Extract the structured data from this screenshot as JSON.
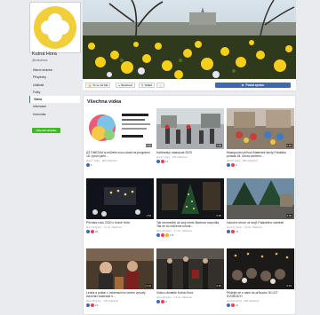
{
  "page": {
    "name": "Kutná Hora",
    "handle": "@kutnahora"
  },
  "nav": [
    {
      "label": "Hlavní stránka",
      "active": false
    },
    {
      "label": "Příspěvky",
      "active": false
    },
    {
      "label": "Události",
      "active": false
    },
    {
      "label": "Fotky",
      "active": false
    },
    {
      "label": "Videa",
      "active": true
    },
    {
      "label": "Informace",
      "active": false
    },
    {
      "label": "Komunita",
      "active": false
    }
  ],
  "create_button": "Vytvořit stránku",
  "actions": {
    "like": "To se mi líbí",
    "follow": "Sledovat",
    "share": "Sdílet",
    "more": "…",
    "send": "Poslat zprávu"
  },
  "section_title": "Všechna videa",
  "videos": [
    {
      "title": "AŽ DNESKA si můžete svou účast na programu 18. výročí jarní...",
      "meta": "před 7 týdny · 486 zhlédnutí",
      "duration": "0:42",
      "reactions": "6"
    },
    {
      "title": "Karlkarský masopust 2020",
      "meta": "před 7 týdny · 925 zhlédnutí",
      "duration": "3:48",
      "reactions": "13"
    },
    {
      "title": "Masopustní průvod Mateřské školy Pohádka pořádá 18. února centrem...",
      "meta": "před 8 týdny · 386 zhlédnutí",
      "duration": "0:45",
      "reactions": "8"
    },
    {
      "title": "Přivítání roku 2020 v Kutné Hoře",
      "meta": "před 10 týdny · 1,1 tis. zhlédnutí",
      "duration": "1:53",
      "reactions": "29"
    },
    {
      "title": "Tak stromeček už stojí místo Barbora rozsvítila. Tak že ho můžeme užívat...",
      "meta": "před 15 týdny · 3,7 tis. zhlédnutí",
      "duration": "0:46",
      "reactions": "115"
    },
    {
      "title": "Vánoční strom už stojí! Palackého náměstí",
      "meta": "před 17 týdny · 1,8 tis. zhlédnutí",
      "duration": "0:46",
      "reactions": "23"
    },
    {
      "title": "Lenka a pošta! v Informačním centru zpívaly Adventní kalendář s …",
      "meta": "před 18 týdny · 454 zhlédnutí",
      "duration": "0:44",
      "reactions": "24"
    },
    {
      "title": "Video uživatele Kutná Hora",
      "meta": "před 18 týdny · 1,5 tis. zhlédnutí",
      "duration": "0:46",
      "reactions": "8"
    },
    {
      "title": "Přidejte se s námi do průvodu! 30 LET SVOBODY!",
      "meta": "před 20 týdny · 948 zhlédnutí",
      "duration": "0:15",
      "reactions": "22"
    }
  ],
  "colors": {
    "brand_blue": "#4267b2",
    "green": "#42b72a",
    "logo_yellow": "#f0cf3a"
  }
}
